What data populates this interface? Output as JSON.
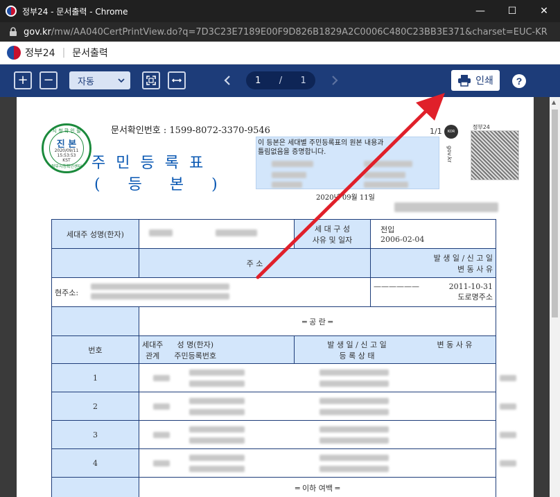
{
  "window": {
    "title": "정부24 - 문서출력 - Chrome",
    "controls": {
      "minimize": "—",
      "maximize": "☐",
      "close": "✕"
    }
  },
  "address": {
    "domain": "gov.kr",
    "path": "/mw/AA040CertPrintView.do?q=7D3C23E7189E00F9D826B1829A2C0006C480C23BB3E371&charset=EUC-KR"
  },
  "appbar": {
    "brand": "정부24",
    "separator": "|",
    "page": "문서출력"
  },
  "toolbar": {
    "zoom_in": "+",
    "zoom_out": "−",
    "zoom_value": "자동",
    "page_current": "1",
    "page_sep": "/",
    "page_total": "1",
    "print_label": "인쇄",
    "help": "?"
  },
  "document": {
    "doc_number": "문서확인번호 : 1599-8072-3370-9546",
    "page_fraction": "1/1",
    "title": "주민등록표",
    "subtitle": "(등본)",
    "cert_text_line1": "이 등본은 세대별 주민등록표의 원본 내용과",
    "cert_text_line2": "틀림없음을 증명합니다.",
    "issue_date": "2020년 09월 11일",
    "qr_label": "정부24",
    "side_url": "gov.kr",
    "seal": {
      "top": "시 청 확 인 필",
      "main": "진 본",
      "date_line1": "2020/09/11",
      "date_line2": "15:53:53",
      "date_line3": "KST",
      "bottom": "정부시청확인센터"
    },
    "table": {
      "head_name_label": "세대주 성명(한자)",
      "head_reason_label1": "세 대 구 성",
      "head_reason_label2": "사유 및 일자",
      "head_reason_value1": "전입",
      "head_reason_value2": "2006-02-04",
      "addr_header": "주                      소",
      "date_header1": "발 생 일   /   신 고 일",
      "date_header2": "변     동     사     유",
      "current_addr_label": "현주소:",
      "current_addr_dash": "——————",
      "current_addr_date": "2011-10-31",
      "current_addr_reason": "도로명주소",
      "blank_marker": "═    공    란    ═",
      "col_no": "번호",
      "col_relation1": "세대주",
      "col_relation2": "관계",
      "col_name1": "성  명(한자)",
      "col_name2": "주민등록번호",
      "col_date1": "발 생 일  /  신 고 일",
      "col_date2": "등 록 상 태",
      "col_change": "변 동 사 유",
      "rows": [
        "1",
        "2",
        "3",
        "4"
      ],
      "end_marker": "═ 이하 여백 ═"
    }
  }
}
